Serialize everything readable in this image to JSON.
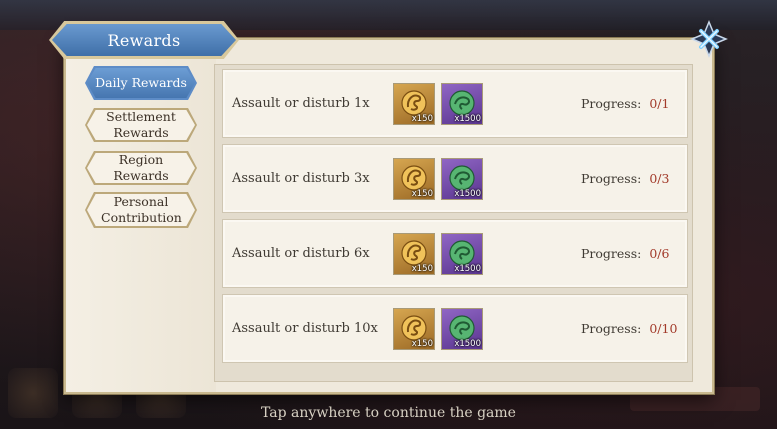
{
  "panel": {
    "title": "Rewards"
  },
  "tabs": [
    {
      "label": "Daily Rewards",
      "active": true
    },
    {
      "label": "Settlement Rewards",
      "active": false
    },
    {
      "label": "Region Rewards",
      "active": false
    },
    {
      "label": "Personal Contribution",
      "active": false
    }
  ],
  "rewards": [
    {
      "task": "Assault or disturb 1x",
      "item1_qty": "x150",
      "item2_qty": "x1500",
      "progress_label": "Progress:",
      "progress_value": "0/1"
    },
    {
      "task": "Assault or disturb 3x",
      "item1_qty": "x150",
      "item2_qty": "x1500",
      "progress_label": "Progress:",
      "progress_value": "0/3"
    },
    {
      "task": "Assault or disturb 6x",
      "item1_qty": "x150",
      "item2_qty": "x1500",
      "progress_label": "Progress:",
      "progress_value": "0/6"
    },
    {
      "task": "Assault or disturb 10x",
      "item1_qty": "x150",
      "item2_qty": "x1500",
      "progress_label": "Progress:",
      "progress_value": "0/10"
    }
  ],
  "footer": {
    "hint": "Tap anywhere to continue the game"
  },
  "icons": {
    "close": "close-icon",
    "item1": "gold-dragon-token-icon",
    "item2": "green-dragon-medal-icon"
  },
  "colors": {
    "accent": "#4a7ab5",
    "progress_value": "#a23a2a",
    "panel_bg": "#efe9dc"
  }
}
